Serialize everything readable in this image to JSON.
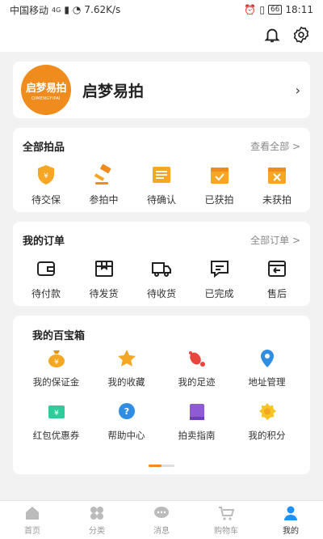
{
  "status_bar": {
    "carrier": "中国移动",
    "network": "4G",
    "speed": "7.62K/s",
    "battery": "66",
    "time": "18:11"
  },
  "header": {
    "icons": [
      "bell-icon",
      "settings-gear-icon"
    ]
  },
  "profile": {
    "logo_text": "启梦易拍",
    "logo_subtext": "QIMENGYIPAI",
    "name": "启梦易拍"
  },
  "auction": {
    "title": "全部拍品",
    "view_all": "查看全部 >",
    "items": [
      {
        "label": "待交保",
        "icon": "shield-yen-icon"
      },
      {
        "label": "参拍中",
        "icon": "gavel-icon"
      },
      {
        "label": "待确认",
        "icon": "document-list-icon"
      },
      {
        "label": "已获拍",
        "icon": "box-check-icon"
      },
      {
        "label": "未获拍",
        "icon": "box-x-icon"
      }
    ]
  },
  "orders": {
    "title": "我的订单",
    "view_all": "全部订单 >",
    "items": [
      {
        "label": "待付款",
        "icon": "wallet-icon"
      },
      {
        "label": "待发货",
        "icon": "package-icon"
      },
      {
        "label": "待收货",
        "icon": "truck-icon"
      },
      {
        "label": "已完成",
        "icon": "chat-done-icon"
      },
      {
        "label": "售后",
        "icon": "return-box-icon"
      }
    ]
  },
  "toolbox": {
    "title": "我的百宝箱",
    "items": [
      {
        "label": "我的保证金",
        "icon": "money-bag-icon"
      },
      {
        "label": "我的收藏",
        "icon": "star-icon"
      },
      {
        "label": "我的足迹",
        "icon": "footprint-icon"
      },
      {
        "label": "地址管理",
        "icon": "location-pin-icon"
      },
      {
        "label": "红包优惠券",
        "icon": "coupon-icon"
      },
      {
        "label": "帮助中心",
        "icon": "help-bubble-icon"
      },
      {
        "label": "拍卖指南",
        "icon": "guide-book-icon"
      },
      {
        "label": "我的积分",
        "icon": "points-badge-icon"
      }
    ]
  },
  "tabbar": {
    "tabs": [
      {
        "label": "首页",
        "icon": "home-icon"
      },
      {
        "label": "分类",
        "icon": "category-icon"
      },
      {
        "label": "消息",
        "icon": "message-icon"
      },
      {
        "label": "购物车",
        "icon": "cart-icon"
      },
      {
        "label": "我的",
        "icon": "user-icon"
      }
    ],
    "active": "我的"
  },
  "colors": {
    "accent": "#f08c1e",
    "background": "#f2f2f2",
    "active_tab": "#1e90ff"
  }
}
